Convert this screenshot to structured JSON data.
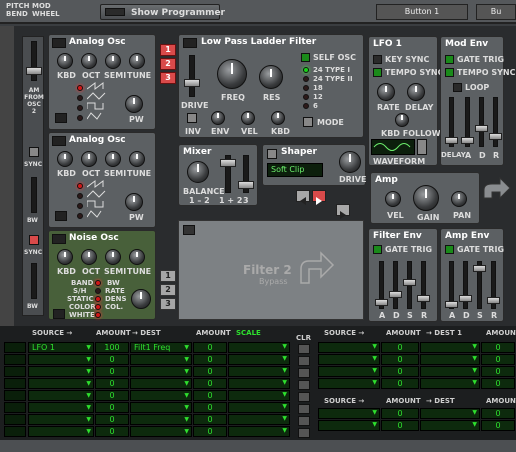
{
  "top": {
    "pitch_bend": "PITCH\nBEND",
    "mod_wheel": "MOD\nWHEEL",
    "show_programmer": "Show Programmer",
    "button1": "Button 1",
    "button2": "Bu"
  },
  "side": {
    "am_from_osc2": "AM FROM OSC 2",
    "sync": "SYNC",
    "bw": "BW",
    "sync2": "SYNC",
    "bw2": "BW"
  },
  "osc1": {
    "title": "Analog Osc",
    "kbd": "KBD",
    "oct": "OCT",
    "semi": "SEMI",
    "tune": "TUNE",
    "pw": "PW"
  },
  "osc2": {
    "title": "Analog Osc",
    "kbd": "KBD",
    "oct": "OCT",
    "semi": "SEMI",
    "tune": "TUNE",
    "pw": "PW"
  },
  "noise": {
    "title": "Noise Osc",
    "kbd": "KBD",
    "oct": "OCT",
    "semi": "SEMI",
    "tune": "TUNE",
    "modes": [
      "BAND",
      "S/H",
      "STATIC",
      "COLOR",
      "WHITE"
    ],
    "params": [
      "BW",
      "RATE",
      "DENS",
      "COL."
    ]
  },
  "route": {
    "r1": "1",
    "r2": "2",
    "r3": "3"
  },
  "filter": {
    "title": "Low Pass Ladder Filter",
    "self_osc": "SELF OSC",
    "types": [
      "24 TYPE I",
      "24 TYPE II",
      "18",
      "12",
      "6"
    ],
    "drive": "DRIVE",
    "freq": "FREQ",
    "res": "RES",
    "inv": "INV",
    "env": "ENV",
    "vel": "VEL",
    "kbd": "KBD",
    "mode": "MODE"
  },
  "mixer": {
    "title": "Mixer",
    "balance": "BALANCE",
    "b12": "1 – 2",
    "b12b": "1 + 2",
    "b3": "3"
  },
  "shaper": {
    "title": "Shaper",
    "mode": "Soft Clip",
    "drive": "DRIVE"
  },
  "amp": {
    "title": "Amp",
    "vel": "VEL",
    "gain": "GAIN",
    "pan": "PAN"
  },
  "lfo1": {
    "title": "LFO 1",
    "key_sync": "KEY SYNC",
    "tempo_sync": "TEMPO SYNC",
    "rate": "RATE",
    "delay": "DELAY",
    "kbd_follow": "KBD FOLLOW",
    "waveform": "WAVEFORM"
  },
  "modenv": {
    "title": "Mod Env",
    "gate_trig": "GATE TRIG",
    "tempo_sync": "TEMPO SYNC",
    "loop": "LOOP",
    "delay": "DELAY",
    "a": "A",
    "d": "D",
    "r": "R"
  },
  "filter2": {
    "title": "Filter 2",
    "bypass": "Bypass"
  },
  "filterenv": {
    "title": "Filter Env",
    "gate_trig": "GATE TRIG",
    "labels": [
      "A",
      "D",
      "S",
      "R"
    ]
  },
  "ampenv": {
    "title": "Amp Env",
    "gate_trig": "GATE TRIG",
    "labels": [
      "A",
      "D",
      "S",
      "R"
    ]
  },
  "matrix": {
    "left_headers": {
      "source": "SOURCE →",
      "amount": "AMOUNT",
      "dest": "→ DEST",
      "amount2": "AMOUNT",
      "scale": "SCALE"
    },
    "clr": "CLR",
    "right_headers": {
      "source": "SOURCE →",
      "amount": "AMOUNT",
      "dest1": "→ DEST 1",
      "amount2": "AMOUNT",
      "dest": "→ DEST"
    },
    "rows": [
      {
        "source": "LFO 1",
        "amount": "100",
        "dest": "Filt1 Freq",
        "amount2": "0"
      },
      {
        "source": "",
        "amount": "0",
        "dest": "",
        "amount2": "0"
      },
      {
        "source": "",
        "amount": "0",
        "dest": "",
        "amount2": "0"
      },
      {
        "source": "",
        "amount": "0",
        "dest": "",
        "amount2": "0"
      },
      {
        "source": "",
        "amount": "0",
        "dest": "",
        "amount2": "0"
      },
      {
        "source": "",
        "amount": "0",
        "dest": "",
        "amount2": "0"
      },
      {
        "source": "",
        "amount": "0",
        "dest": "",
        "amount2": "0"
      },
      {
        "source": "",
        "amount": "0",
        "dest": "",
        "amount2": "0"
      }
    ],
    "right_rows": [
      {
        "amount": "0",
        "amount2": "0"
      },
      {
        "amount": "0",
        "amount2": "0"
      },
      {
        "amount": "0",
        "amount2": "0"
      },
      {
        "amount": "0",
        "amount2": "0"
      }
    ],
    "right_rows2": [
      {
        "amount": "0",
        "amount2": "0"
      },
      {
        "amount": "0",
        "amount2": "0"
      }
    ]
  },
  "colors": {
    "panel": "#5c6063",
    "noise_panel": "#48603a",
    "led_red": "#d01818",
    "led_green": "#18d018",
    "lcd_text": "#2ee02e"
  }
}
